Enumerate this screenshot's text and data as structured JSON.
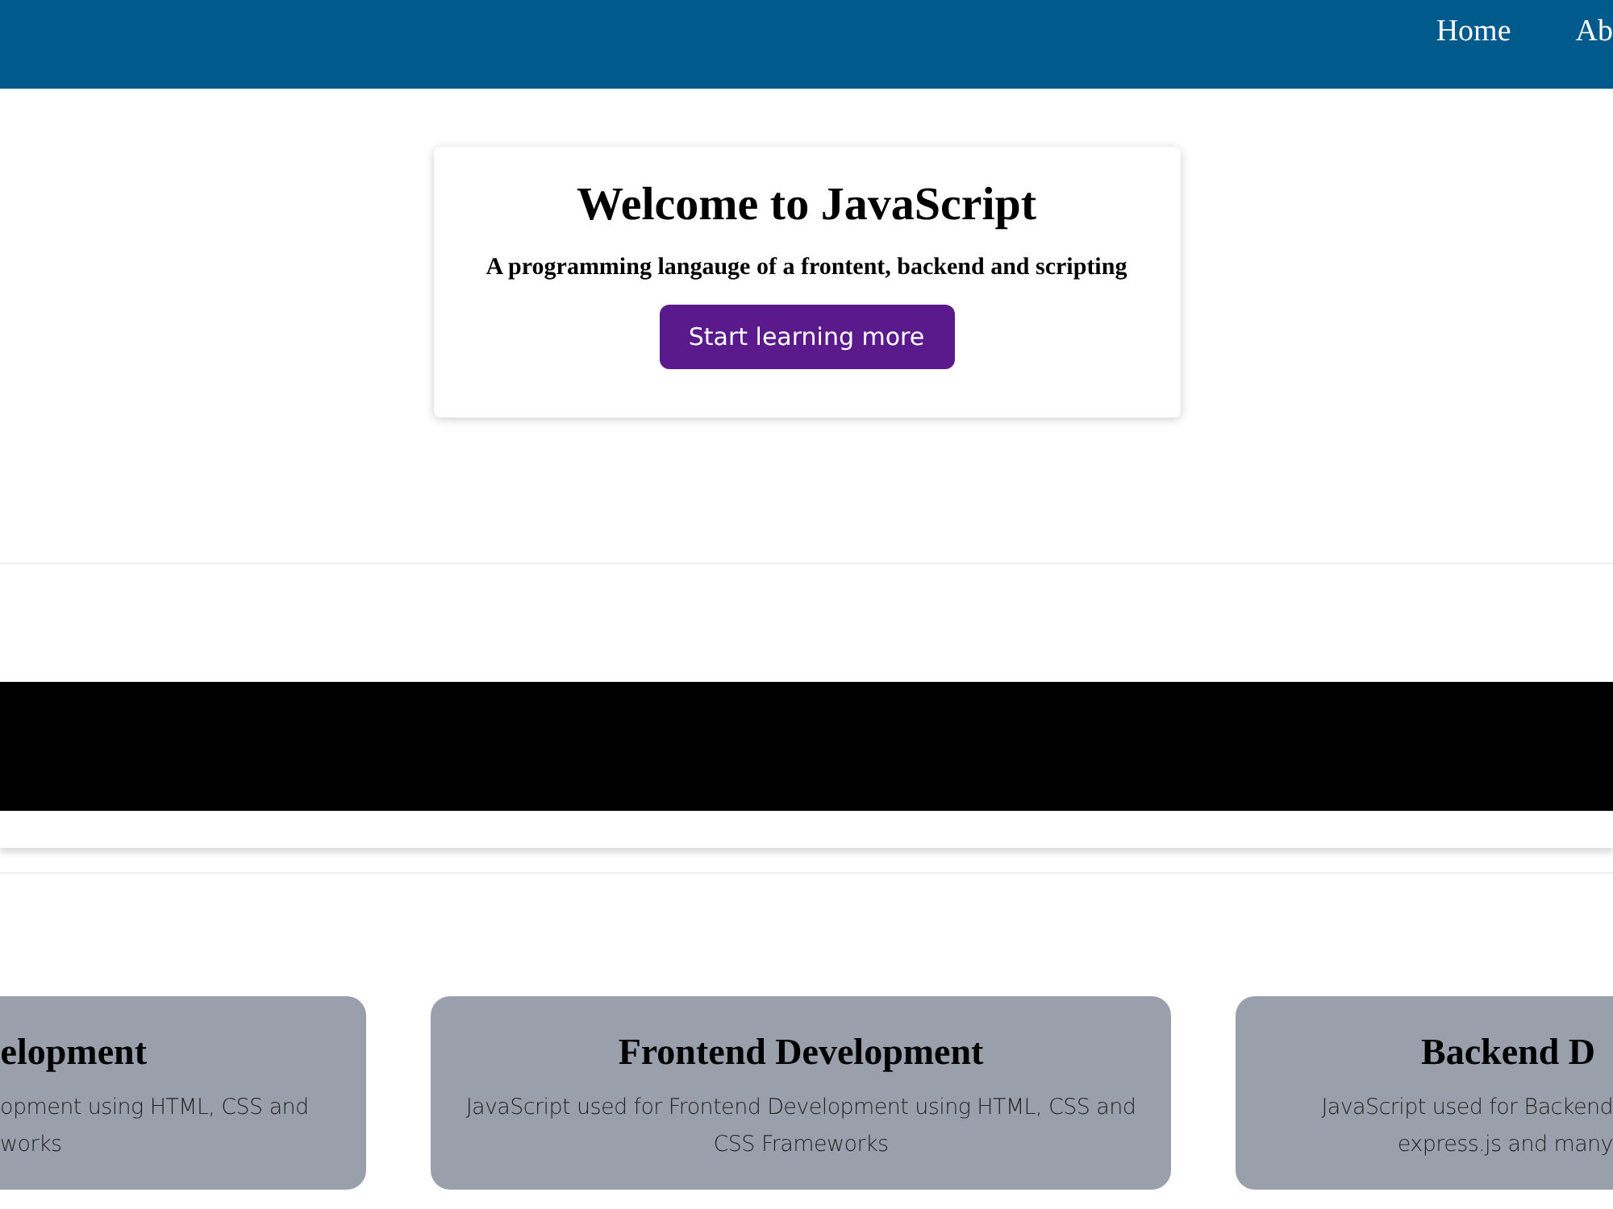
{
  "nav": {
    "links": [
      "Home",
      "Ab"
    ]
  },
  "hero": {
    "title": "Welcome to JavaScript",
    "subtitle": "A programming langauge of a frontent, backend and scripting",
    "button": "Start learning more"
  },
  "cards": [
    {
      "kind": "cut-left",
      "title": "elopment",
      "description_lines": [
        "opment using HTML, CSS and",
        "works"
      ]
    },
    {
      "kind": "full",
      "title": "Frontend Development",
      "description_lines": [
        "JavaScript used for Frontend Development using HTML, CSS and",
        "CSS Frameworks"
      ]
    },
    {
      "kind": "cut-right",
      "title": "Backend D",
      "description_lines": [
        "JavaScript used for Backend",
        "express.js and many"
      ]
    }
  ]
}
